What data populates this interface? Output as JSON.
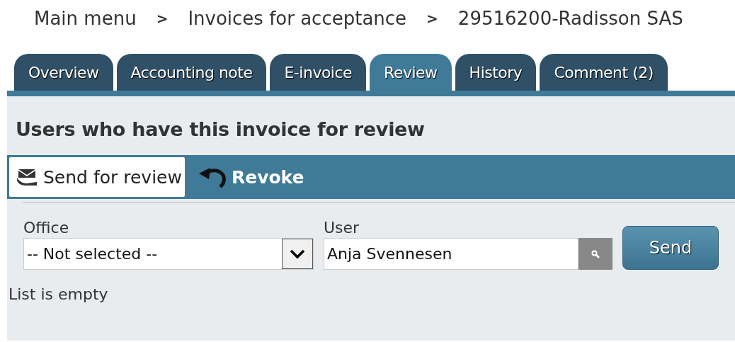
{
  "breadcrumb": [
    {
      "label": "Main menu"
    },
    {
      "label": "Invoices for acceptance"
    },
    {
      "label": "29516200-Radisson SAS"
    }
  ],
  "breadcrumb_separator": ">",
  "tabs": [
    {
      "label": "Overview",
      "selected": false
    },
    {
      "label": "Accounting note",
      "selected": false
    },
    {
      "label": "E-invoice",
      "selected": false
    },
    {
      "label": "Review",
      "selected": true
    },
    {
      "label": "History",
      "selected": false
    },
    {
      "label": "Comment (2)",
      "selected": false
    }
  ],
  "heading": "Users who have this invoice for review",
  "toolbar": [
    {
      "label": "Send for review",
      "kind": "send",
      "selected": true
    },
    {
      "label": "Revoke",
      "kind": "revoke",
      "selected": false
    }
  ],
  "office": {
    "label": "Office",
    "value": "-- Not selected --"
  },
  "user": {
    "label": "User",
    "value": "Anja Svennesen"
  },
  "send_button": "Send",
  "status": "List is empty"
}
